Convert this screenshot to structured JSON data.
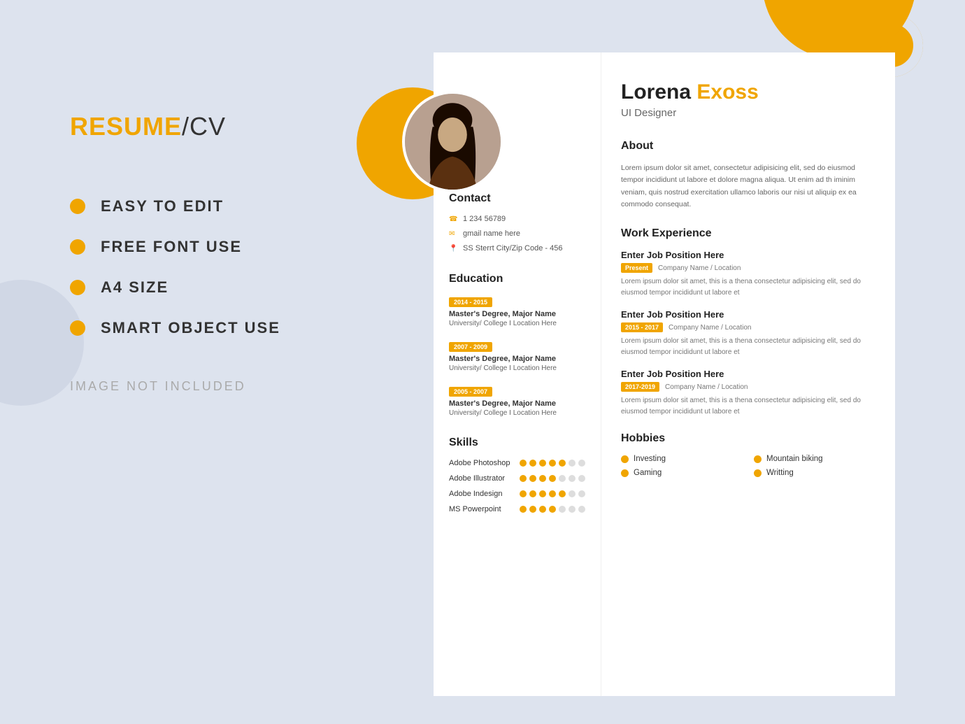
{
  "page": {
    "bg_color": "#dde3ee"
  },
  "left_panel": {
    "title_highlight": "RESUME",
    "title_slash": "/CV",
    "features": [
      "EASY TO EDIT",
      "FREE FONT USE",
      "A4 SIZE",
      "SMART OBJECT USE"
    ],
    "image_note": "IMAGE NOT INCLUDED"
  },
  "resume": {
    "first_name": "Lorena",
    "last_name": "Exoss",
    "title": "UI Designer",
    "contact": {
      "header": "Contact",
      "phone": "1 234 56789",
      "email": "gmail name here",
      "address": "SS Sterrt City/Zip Code - 456"
    },
    "education": {
      "header": "Education",
      "entries": [
        {
          "years": "2014 - 2015",
          "degree": "Master's Degree, Major Name",
          "school": "University/ College I Location Here"
        },
        {
          "years": "2007 - 2009",
          "degree": "Master's Degree, Major Name",
          "school": "University/ College I Location Here"
        },
        {
          "years": "2005 - 2007",
          "degree": "Master's Degree, Major Name",
          "school": "University/ College I Location Here"
        }
      ]
    },
    "skills": {
      "header": "Skills",
      "items": [
        {
          "name": "Adobe Photoshop",
          "filled": 5,
          "total": 7
        },
        {
          "name": "Adobe Illustrator",
          "filled": 4,
          "total": 7
        },
        {
          "name": "Adobe Indesign",
          "filled": 5,
          "total": 7
        },
        {
          "name": "MS Powerpoint",
          "filled": 4,
          "total": 7
        }
      ]
    },
    "about": {
      "header": "About",
      "text": "Lorem ipsum dolor sit amet, consectetur adipisicing elit, sed do eiusmod tempor incididunt ut labore et dolore magna aliqua. Ut enim ad th iminim veniam, quis nostrud exercitation ullamco laboris our nisi ut aliquip ex ea commodo consequat."
    },
    "work": {
      "header": "Work Experience",
      "entries": [
        {
          "job_title": "Enter Job Position Here",
          "badge": "Present",
          "company": "Company Name / Location",
          "desc": "Lorem ipsum dolor sit amet, this is a thena  consectetur adipisicing elit, sed do eiusmod tempor incididunt ut labore et"
        },
        {
          "job_title": "Enter Job Position Here",
          "badge": "2015 - 2017",
          "company": "Company Name / Location",
          "desc": "Lorem ipsum dolor sit amet, this is a thena  consectetur adipisicing elit, sed do eiusmod tempor incididunt ut labore et"
        },
        {
          "job_title": "Enter Job Position Here",
          "badge": "2017-2019",
          "company": "Company Name / Location",
          "desc": "Lorem ipsum dolor sit amet, this is a thena  consectetur adipisicing elit, sed do eiusmod tempor incididunt ut labore et"
        }
      ]
    },
    "hobbies": {
      "header": "Hobbies",
      "items": [
        "Investing",
        "Mountain biking",
        "Gaming",
        "Writting"
      ]
    }
  }
}
